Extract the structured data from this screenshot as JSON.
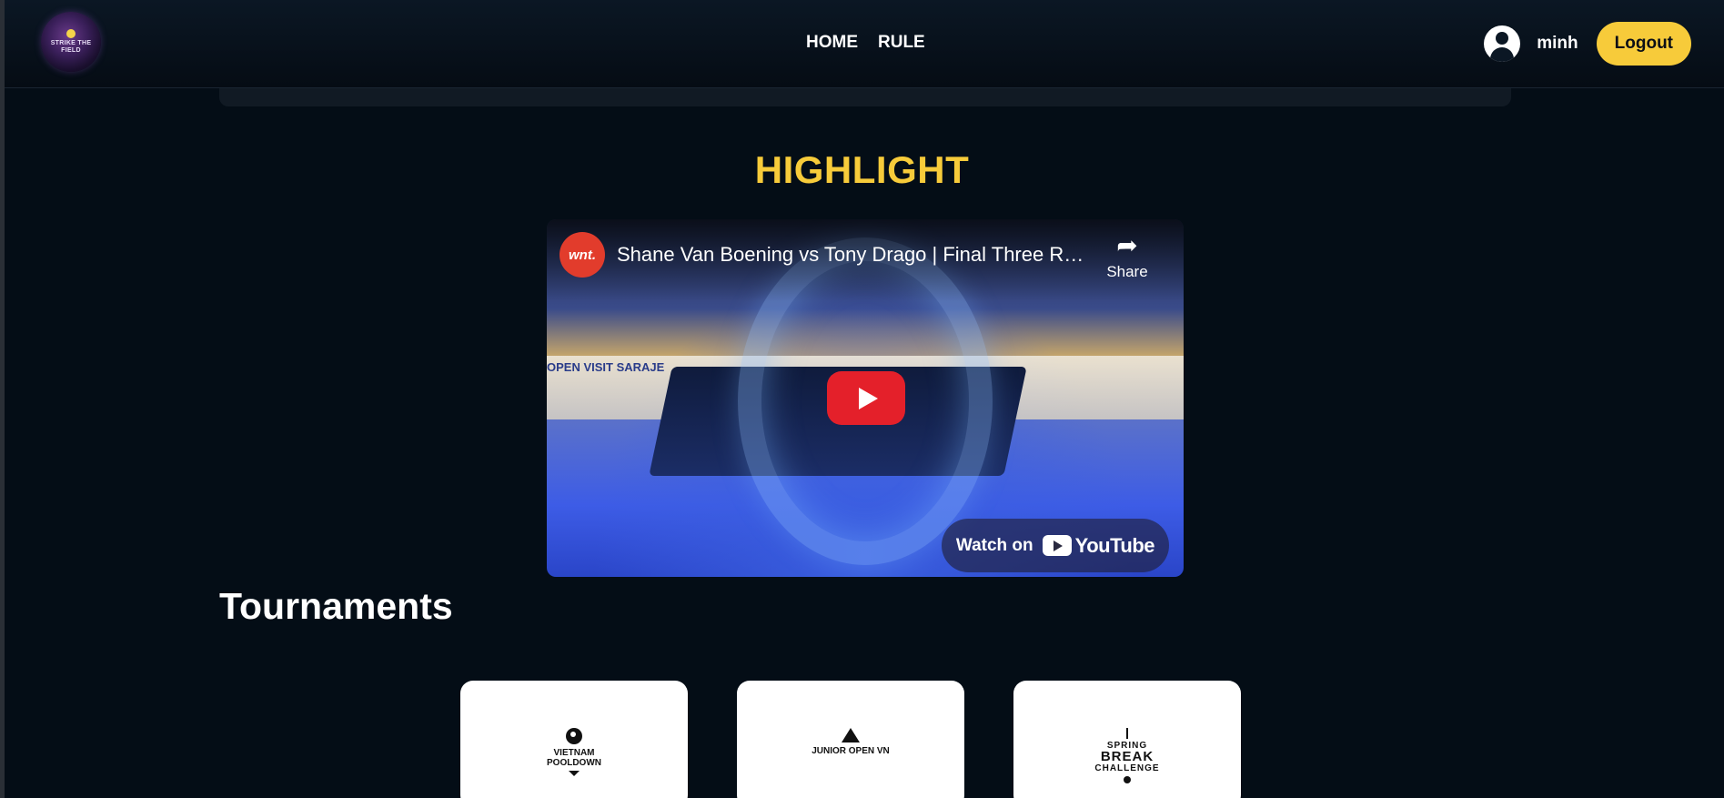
{
  "header": {
    "logo_text": "STRIKE THE FIELD",
    "nav": [
      {
        "label": "HOME"
      },
      {
        "label": "RULE"
      }
    ],
    "username": "minh",
    "logout_label": "Logout"
  },
  "highlight": {
    "title": "HIGHLIGHT",
    "video": {
      "channel_badge": "wnt.",
      "title": "Shane Van Boening vs Tony Drago | Final Three Ra...",
      "share_label": "Share",
      "watch_on_label": "Watch on",
      "youtube_label": "YouTube",
      "board_text": "OPEN   VISIT SARAJE"
    }
  },
  "tournaments": {
    "title": "Tournaments",
    "cards": [
      {
        "line1": "VIETNAM",
        "line2": "POOLDOWN"
      },
      {
        "line1": "JUNIOR OPEN VN"
      },
      {
        "line1": "SPRING",
        "line2": "BREAK",
        "line3": "CHALLENGE"
      }
    ]
  },
  "colors": {
    "accent": "#f7cb3a",
    "background": "#040d16",
    "play_button": "#e4202a"
  },
  "icons": {
    "avatar": "user-circle-icon",
    "share": "share-arrow-icon",
    "play": "play-icon",
    "youtube": "youtube-logo-icon"
  }
}
